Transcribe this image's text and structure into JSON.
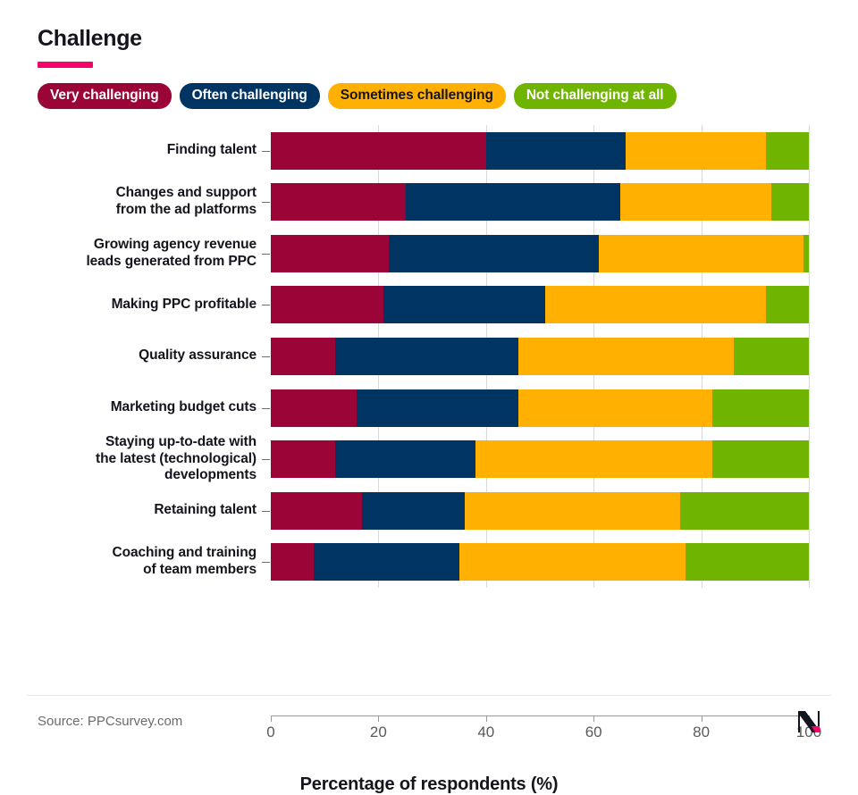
{
  "header": {
    "title": "Challenge",
    "accent_color": "#f5056b"
  },
  "legend": {
    "items": [
      {
        "label": "Very challenging",
        "color": "#9b0437",
        "text_color": "#ffffff"
      },
      {
        "label": "Often challenging",
        "color": "#003463",
        "text_color": "#ffffff"
      },
      {
        "label": "Sometimes challenging",
        "color": "#ffb000",
        "text_color": "#14141e"
      },
      {
        "label": "Not challenging at all",
        "color": "#6fb500",
        "text_color": "#ffffff"
      }
    ]
  },
  "footer": {
    "source": "Source: PPCsurvey.com"
  },
  "chart_data": {
    "type": "bar",
    "orientation": "horizontal",
    "stacked": true,
    "stack_total": 100,
    "title": "Challenge",
    "xlabel": "Percentage of respondents (%)",
    "ylabel": "",
    "xlim": [
      0,
      100
    ],
    "xticks": [
      0,
      20,
      40,
      60,
      80,
      100
    ],
    "xtick_labels": [
      "0",
      "20",
      "40",
      "60",
      "80",
      "100"
    ],
    "grid": true,
    "legend_position": "top",
    "categories": [
      "Finding talent",
      "Changes and support from the ad platforms",
      "Growing agency revenue leads generated from PPC",
      "Making PPC profitable",
      "Quality assurance",
      "Marketing budget cuts",
      "Staying up-to-date with the latest (technological) developments",
      "Retaining talent",
      "Coaching and training of team members"
    ],
    "category_lines": [
      [
        "Finding talent"
      ],
      [
        "Changes and support",
        "from the ad platforms"
      ],
      [
        "Growing agency revenue",
        "leads generated from PPC"
      ],
      [
        "Making PPC profitable"
      ],
      [
        "Quality assurance"
      ],
      [
        "Marketing budget cuts"
      ],
      [
        "Staying up-to-date with",
        "the latest (technological)",
        "developments"
      ],
      [
        "Retaining talent"
      ],
      [
        "Coaching and training",
        "of team members"
      ]
    ],
    "series": [
      {
        "name": "Very challenging",
        "color": "#9b0437",
        "values": [
          40,
          25,
          22,
          21,
          12,
          16,
          12,
          17,
          8
        ]
      },
      {
        "name": "Often challenging",
        "color": "#003463",
        "values": [
          26,
          40,
          39,
          30,
          34,
          30,
          26,
          19,
          27
        ]
      },
      {
        "name": "Sometimes challenging",
        "color": "#ffb000",
        "values": [
          26,
          28,
          38,
          41,
          40,
          36,
          44,
          40,
          42
        ]
      },
      {
        "name": "Not challenging at all",
        "color": "#6fb500",
        "values": [
          8,
          7,
          1,
          8,
          14,
          18,
          18,
          24,
          23
        ]
      }
    ]
  }
}
